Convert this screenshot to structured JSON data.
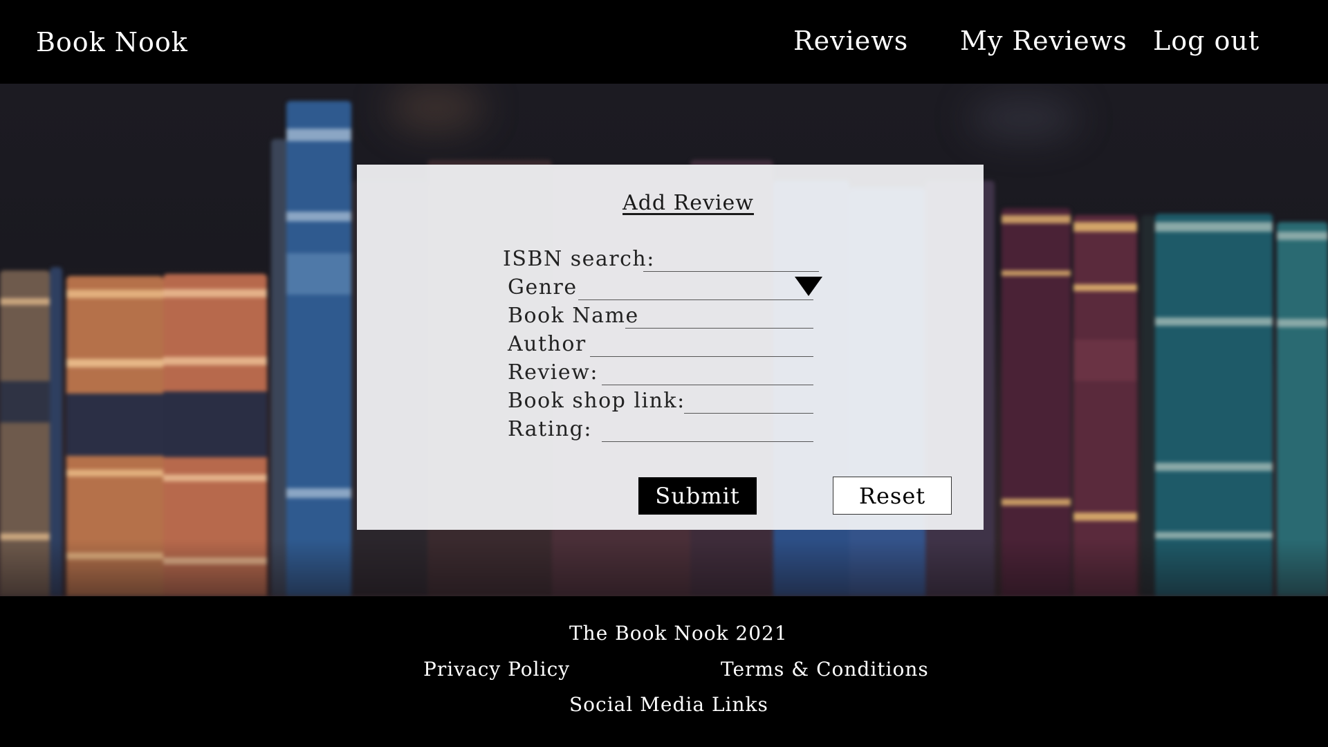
{
  "header": {
    "brand": "Book Nook",
    "nav": {
      "reviews": "Reviews",
      "my_reviews": "My Reviews",
      "log_out": "Log out"
    }
  },
  "form": {
    "title": "Add Review",
    "fields": {
      "isbn": "ISBN search:",
      "genre": "Genre",
      "book_name": "Book Name",
      "author": "Author",
      "review": "Review:",
      "shop_link": "Book shop link:",
      "rating": "Rating:"
    },
    "submit_label": "Submit",
    "reset_label": "Reset"
  },
  "footer": {
    "copyright": "The Book Nook 2021",
    "privacy": "Privacy Policy",
    "terms": "Terms & Conditions",
    "social": "Social Media Links"
  },
  "colors": {
    "header_bg": "#000000",
    "footer_bg": "#000000",
    "card_bg": "#f3f4f6",
    "submit_bg": "#000000",
    "reset_bg": "#ffffff"
  },
  "icons": {
    "genre_dropdown": "caret-down-icon"
  }
}
